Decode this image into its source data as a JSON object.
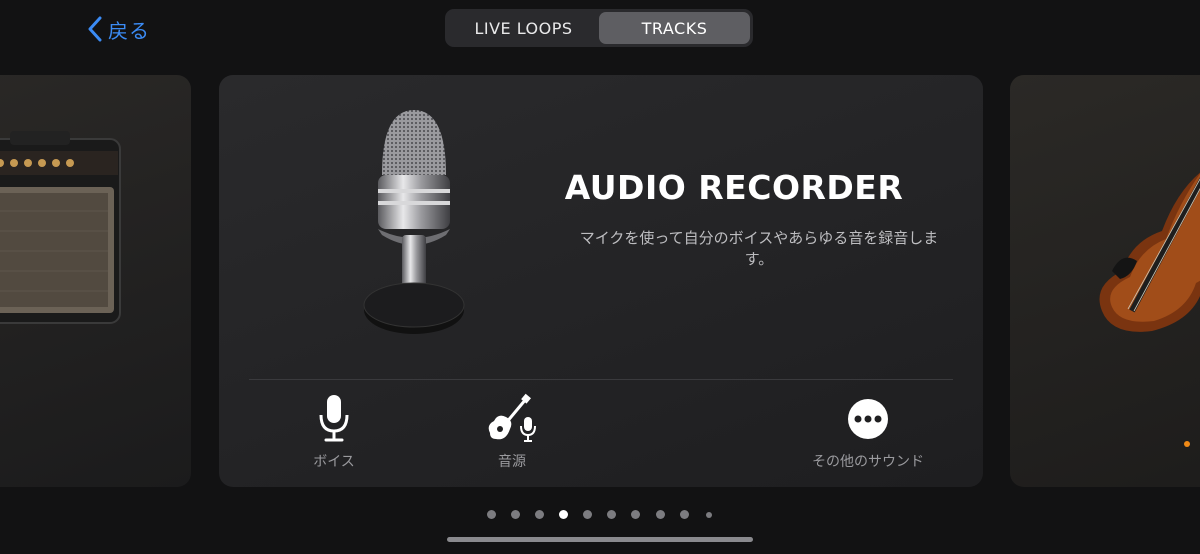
{
  "nav": {
    "back_label": "戻る",
    "tabs": [
      {
        "label": "LIVE LOOPS",
        "active": false
      },
      {
        "label": "TRACKS",
        "active": true
      }
    ]
  },
  "main_card": {
    "title": "AUDIO RECORDER",
    "description": "マイクを使って自分のボイスやあらゆる音を録音します。",
    "options": [
      {
        "label": "ボイス",
        "icon": "microphone-icon"
      },
      {
        "label": "音源",
        "icon": "guitar-mic-icon"
      },
      {
        "label": "その他のサウンド",
        "icon": "more-icon"
      }
    ]
  },
  "pager": {
    "count": 10,
    "active_index": 3
  },
  "colors": {
    "accent": "#3b8bf4",
    "indicator": "#f08a16"
  }
}
